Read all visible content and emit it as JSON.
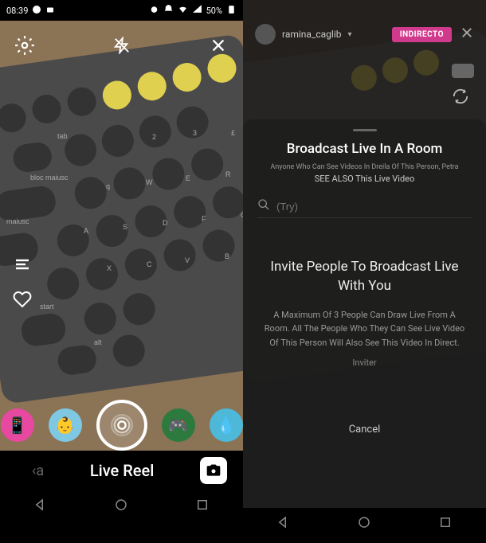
{
  "status": {
    "time": "08:39",
    "battery": "50%"
  },
  "left": {
    "mode_label": "Live Reel"
  },
  "right": {
    "username": "ramina_caglib",
    "badge": "INDIRECTO",
    "sheet": {
      "title": "Broadcast Live In A Room",
      "subtitle": "Anyone Who Can See Videos In Dreila Of This Person, Petra",
      "see_also": "SEE ALSO This Live Video",
      "search_placeholder": "(Try)",
      "invite_title": "Invite People To Broadcast Live With You",
      "invite_desc": "A Maximum Of 3 People Can Draw Live From A Room. All The People Who They Can See Live Video Of This Person Will Also See This Video In Direct.",
      "inviter_label": "Inviter",
      "cancel_label": "Cancel"
    }
  }
}
